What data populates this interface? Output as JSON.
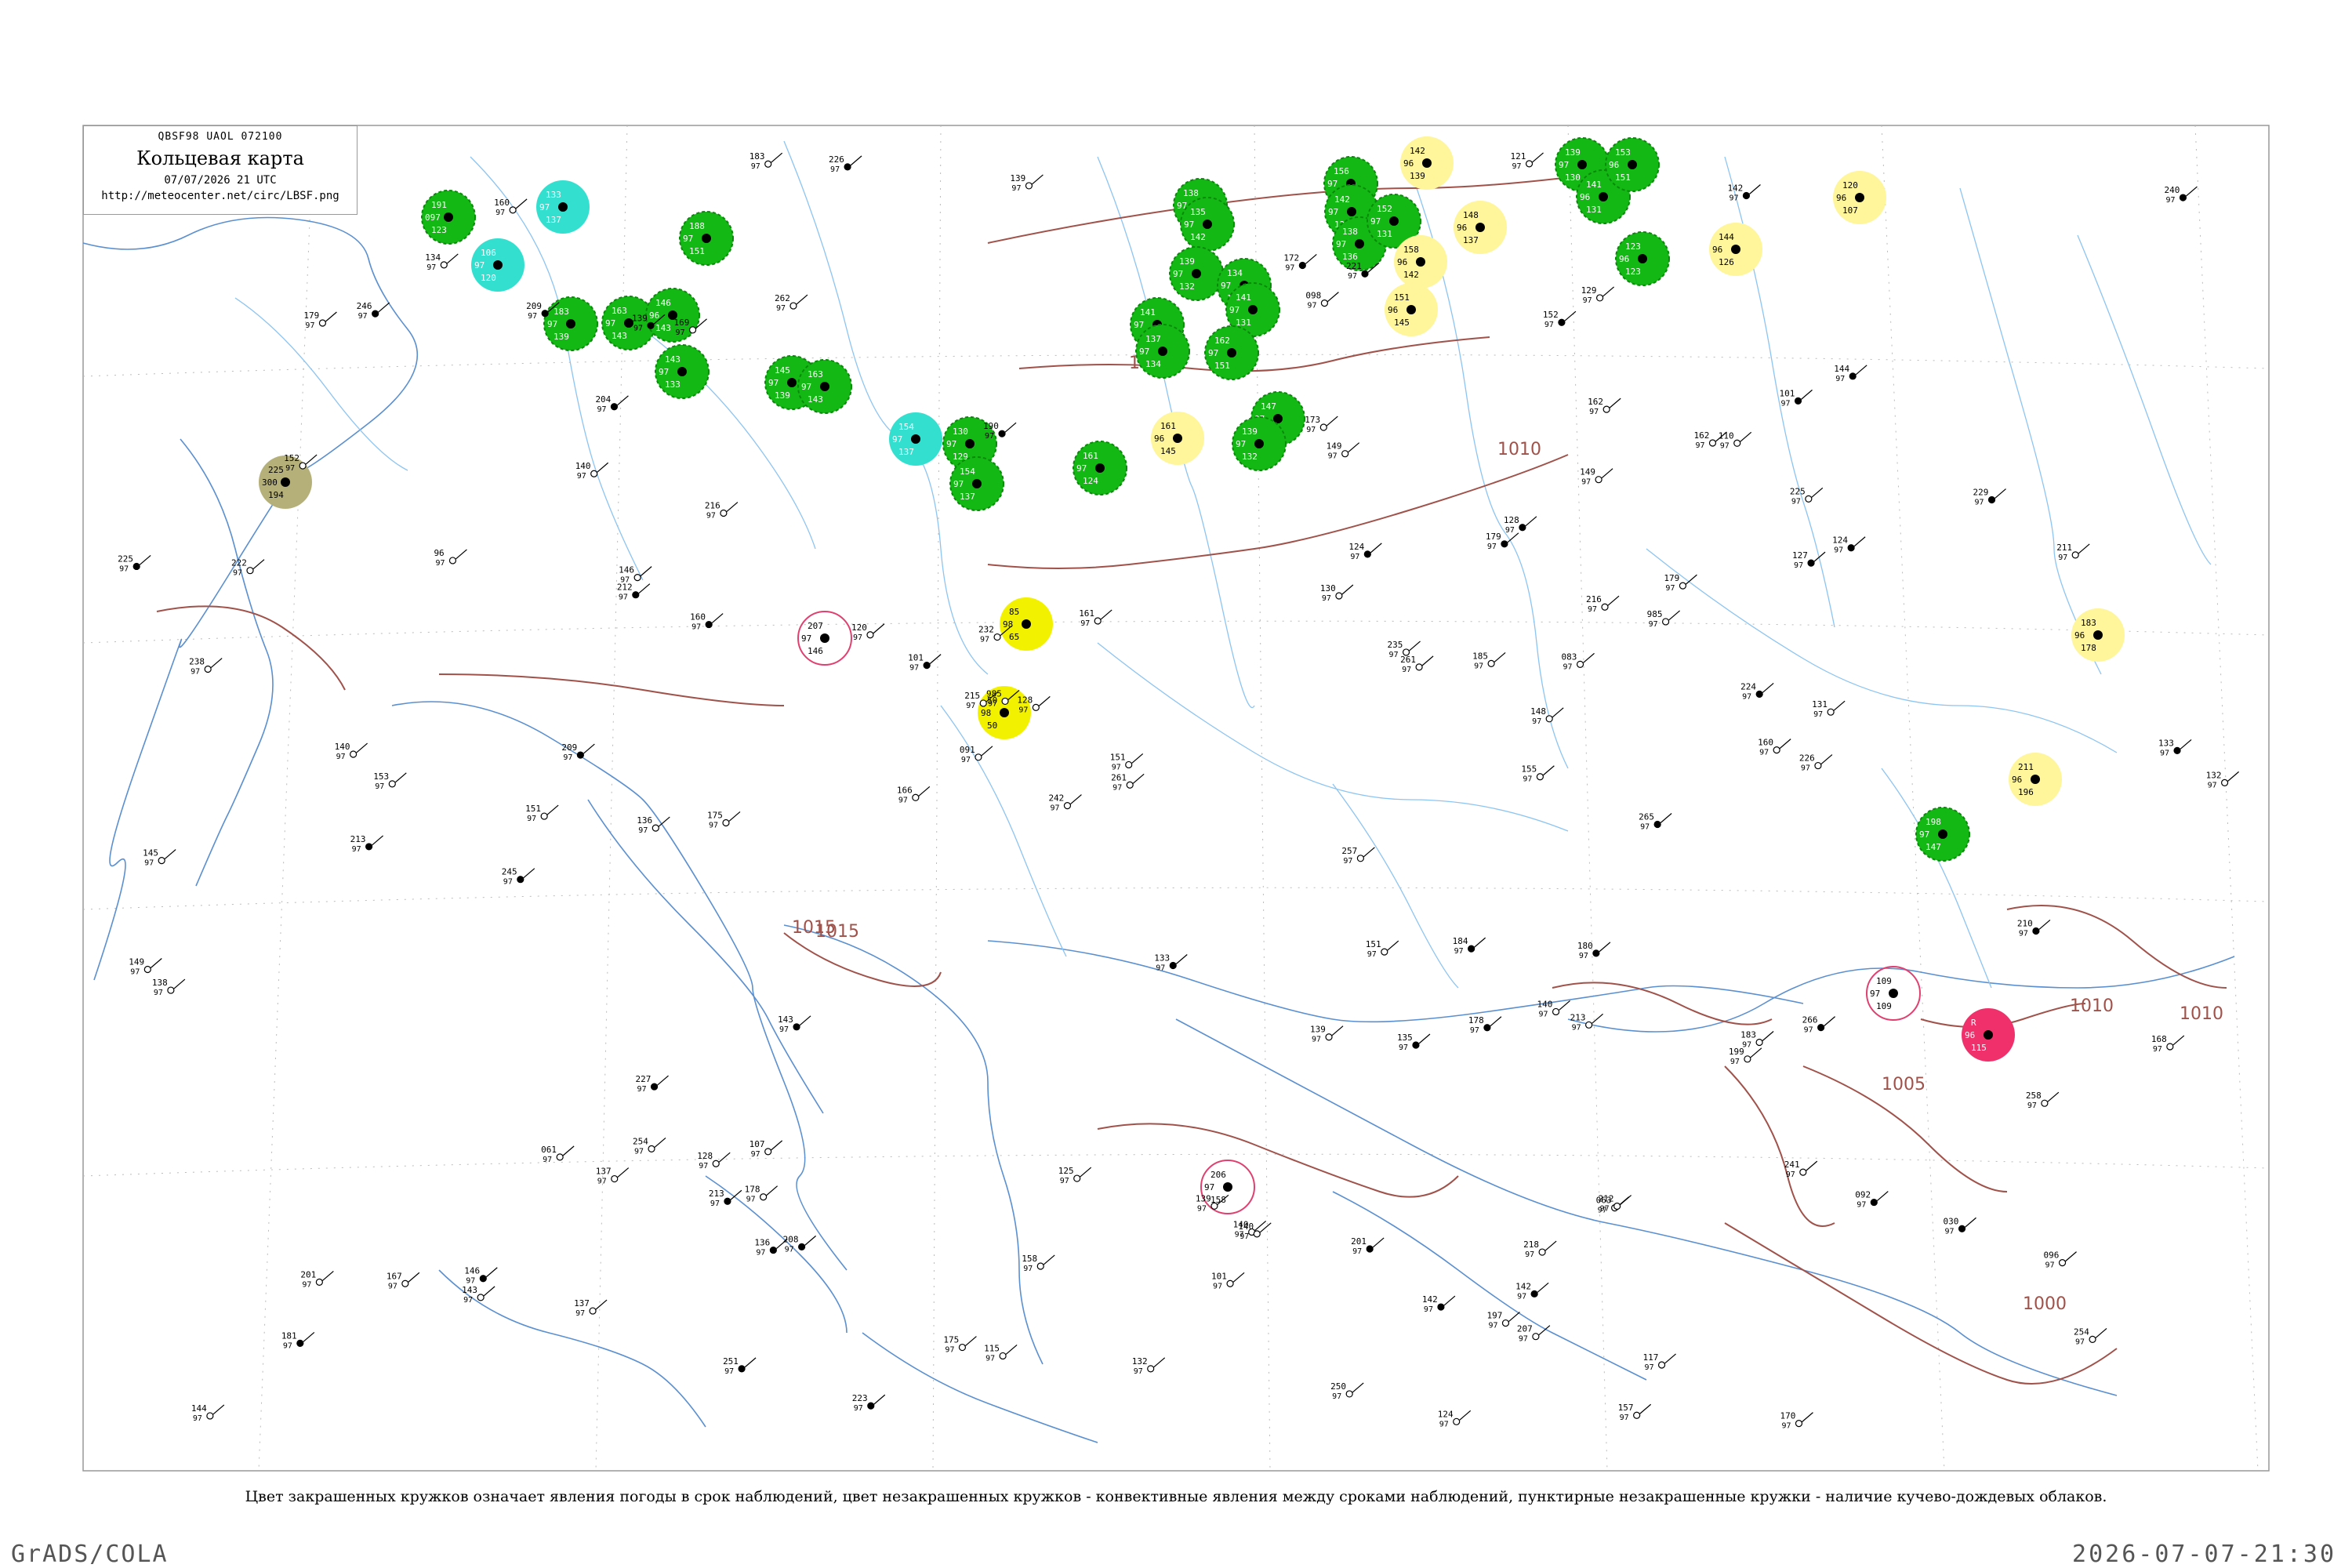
{
  "legend": {
    "code_line": "QBSF98  UAOL  072100",
    "title": "Кольцевая карта",
    "time": "07/07/2026 21 UTC",
    "url": "http://meteocenter.net/circ/LBSF.png"
  },
  "caption": "Цвет закрашенных кружков означает явления погоды в срок наблюдений, цвет незакрашенных кружков - конвективные явления между сроками наблюдений, пунктирные незакрашенные кружки - наличие кучево-дождевых облаков.",
  "footer": {
    "left": "GrADS/COLA",
    "right": "2026-07-07-21:30"
  },
  "isobars": [
    {
      "label": "1005"
    },
    {
      "label": "1010"
    },
    {
      "label": "1015"
    },
    {
      "label": "1000"
    },
    {
      "label": "1005"
    },
    {
      "label": "1010"
    },
    {
      "label": "1010"
    },
    {
      "label": "1015"
    }
  ],
  "colors": {
    "green": "#14b814",
    "cyan": "#33e0d0",
    "yellow_light": "#fff59a",
    "yellow": "#f2f200",
    "olive": "#b5b07a",
    "red": "#f0306a",
    "isobar": "#a0524a",
    "river": "#6aaee8",
    "coast": "#5a8fd0"
  },
  "stations": [
    {
      "kind": "green",
      "temp": "191",
      "pres": "097",
      "dew": "123"
    },
    {
      "kind": "cyan",
      "temp": "133",
      "pres": "97",
      "dew": "137"
    },
    {
      "kind": "cyan",
      "temp": "106",
      "pres": "97",
      "dew": "120"
    },
    {
      "kind": "green",
      "temp": "183",
      "pres": "97",
      "dew": "139"
    },
    {
      "kind": "green",
      "temp": "163",
      "pres": "97",
      "dew": "143"
    },
    {
      "kind": "green",
      "temp": "146",
      "pres": "96",
      "dew": "143"
    },
    {
      "kind": "green",
      "temp": "143",
      "pres": "97",
      "dew": "133"
    },
    {
      "kind": "green",
      "temp": "188",
      "pres": "97",
      "dew": "151"
    },
    {
      "kind": "green",
      "temp": "145",
      "pres": "97",
      "dew": "139"
    },
    {
      "kind": "green",
      "temp": "163",
      "pres": "97",
      "dew": "143"
    },
    {
      "kind": "green",
      "temp": "130",
      "pres": "97",
      "dew": "129"
    },
    {
      "kind": "green",
      "temp": "154",
      "pres": "97",
      "dew": "137"
    },
    {
      "kind": "cyan",
      "temp": "154",
      "pres": "97",
      "dew": "137"
    },
    {
      "kind": "green",
      "temp": "161",
      "pres": "97",
      "dew": "124"
    },
    {
      "kind": "green",
      "temp": "141",
      "pres": "97",
      "dew": "136"
    },
    {
      "kind": "green",
      "temp": "137",
      "pres": "97",
      "dew": "134"
    },
    {
      "kind": "green",
      "temp": "138",
      "pres": "97",
      "dew": "131"
    },
    {
      "kind": "green",
      "temp": "135",
      "pres": "97",
      "dew": "142"
    },
    {
      "kind": "green",
      "temp": "139",
      "pres": "97",
      "dew": "132"
    },
    {
      "kind": "green",
      "temp": "134",
      "pres": "97",
      "dew": "132"
    },
    {
      "kind": "green",
      "temp": "141",
      "pres": "97",
      "dew": "131"
    },
    {
      "kind": "green",
      "temp": "162",
      "pres": "97",
      "dew": "151"
    },
    {
      "kind": "green",
      "temp": "156",
      "pres": "97",
      "dew": "143"
    },
    {
      "kind": "green",
      "temp": "142",
      "pres": "97",
      "dew": "129"
    },
    {
      "kind": "green",
      "temp": "138",
      "pres": "97",
      "dew": "136"
    },
    {
      "kind": "green",
      "temp": "152",
      "pres": "97",
      "dew": "131"
    },
    {
      "kind": "green",
      "temp": "147",
      "pres": "97",
      "dew": "138"
    },
    {
      "kind": "green",
      "temp": "139",
      "pres": "97",
      "dew": "132"
    },
    {
      "kind": "green",
      "temp": "139",
      "pres": "97",
      "dew": "130"
    },
    {
      "kind": "green",
      "temp": "141",
      "pres": "96",
      "dew": "131"
    },
    {
      "kind": "green",
      "temp": "153",
      "pres": "96",
      "dew": "151"
    },
    {
      "kind": "green",
      "temp": "123",
      "pres": "96",
      "dew": "123"
    },
    {
      "kind": "yellow_light",
      "temp": "142",
      "pres": "96",
      "dew": "139"
    },
    {
      "kind": "yellow_light",
      "temp": "148",
      "pres": "96",
      "dew": "137"
    },
    {
      "kind": "yellow_light",
      "temp": "158",
      "pres": "96",
      "dew": "142"
    },
    {
      "kind": "yellow_light",
      "temp": "151",
      "pres": "96",
      "dew": "145"
    },
    {
      "kind": "yellow_light",
      "temp": "144",
      "pres": "96",
      "dew": "126"
    },
    {
      "kind": "yellow_light",
      "temp": "120",
      "pres": "96",
      "dew": "107"
    },
    {
      "kind": "yellow_light",
      "temp": "161",
      "pres": "96",
      "dew": "145"
    },
    {
      "kind": "yellow_light",
      "temp": "183",
      "pres": "96",
      "dew": "178"
    },
    {
      "kind": "yellow_light",
      "temp": "211",
      "pres": "96",
      "dew": "196"
    },
    {
      "kind": "yellow",
      "temp": "85",
      "pres": "98",
      "dew": "65"
    },
    {
      "kind": "yellow",
      "temp": "50",
      "pres": "98",
      "dew": "50"
    },
    {
      "kind": "olive",
      "temp": "225",
      "pres": "300",
      "dew": "194"
    },
    {
      "kind": "green",
      "temp": "198",
      "pres": "97",
      "dew": "147"
    },
    {
      "kind": "red",
      "temp": "R",
      "pres": "96",
      "dew": "115"
    },
    {
      "kind": "open_red",
      "temp": "207",
      "pres": "97",
      "dew": "146"
    },
    {
      "kind": "open_red",
      "temp": "109",
      "pres": "97",
      "dew": "109"
    },
    {
      "kind": "open_red",
      "temp": "206",
      "pres": "97",
      "dew": "158"
    }
  ],
  "small_stations": [
    "179",
    "124",
    "140",
    "146",
    "063",
    "179",
    "101",
    "149",
    "061",
    "030",
    "140",
    "985",
    "160",
    "096",
    "985",
    "144",
    "96",
    "166",
    "133",
    "162",
    "158",
    "124",
    "140",
    "129",
    "221",
    "083",
    "149",
    "101",
    "115",
    "139",
    "139",
    "121",
    "216",
    "190",
    "226",
    "140",
    "135",
    "145",
    "242",
    "128",
    "132",
    "151",
    "210",
    "149",
    "185",
    "266",
    "128",
    "132",
    "245",
    "218",
    "139",
    "181",
    "152",
    "125",
    "136",
    "137",
    "215",
    "225",
    "212",
    "170",
    "201",
    "183",
    "136",
    "178",
    "155",
    "197",
    "152",
    "173",
    "148",
    "143",
    "120",
    "146",
    "213",
    "168",
    "139",
    "127",
    "151",
    "167",
    "226",
    "235",
    "179",
    "246",
    "199",
    "216",
    "209",
    "211",
    "201",
    "223",
    "140",
    "250",
    "227",
    "178",
    "175",
    "265",
    "213",
    "169",
    "142",
    "153",
    "161",
    "180",
    "130",
    "128",
    "124",
    "254",
    "261",
    "229",
    "238",
    "175",
    "240",
    "232",
    "143",
    "251",
    "157",
    "160",
    "142",
    "107",
    "151",
    "172",
    "258",
    "138",
    "213",
    "117",
    "101",
    "209",
    "137",
    "225",
    "208",
    "183",
    "162",
    "092",
    "110",
    "134",
    "212",
    "261",
    "222",
    "142",
    "160",
    "254",
    "133",
    "098",
    "131",
    "184",
    "262",
    "257",
    "224",
    "144",
    "241",
    "204",
    "207",
    "091"
  ]
}
